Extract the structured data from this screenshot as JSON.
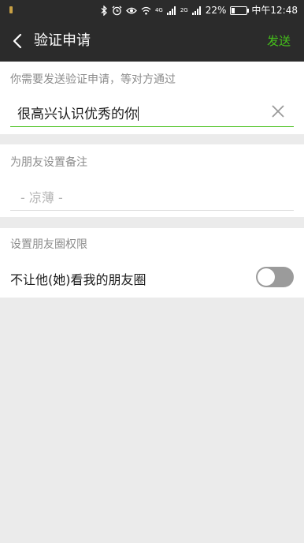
{
  "status_bar": {
    "battery_percent": "22%",
    "time": "中午12:48",
    "network_1": "4G",
    "network_2": "2G",
    "icons": [
      "bluetooth-icon",
      "alarm-icon",
      "eye-icon",
      "wifi-icon",
      "signal-icon",
      "battery-icon"
    ]
  },
  "nav": {
    "title": "验证申请",
    "send_label": "发送",
    "accent_color": "#45c01a"
  },
  "verify": {
    "label": "你需要发送验证申请，等对方通过",
    "value": "很高兴认识优秀的你"
  },
  "remark": {
    "label": "为朋友设置备注",
    "placeholder": "- 凉薄 -"
  },
  "moments": {
    "label": "设置朋友圈权限",
    "toggle_label": "不让他(她)看我的朋友圈",
    "toggle_on": false
  }
}
